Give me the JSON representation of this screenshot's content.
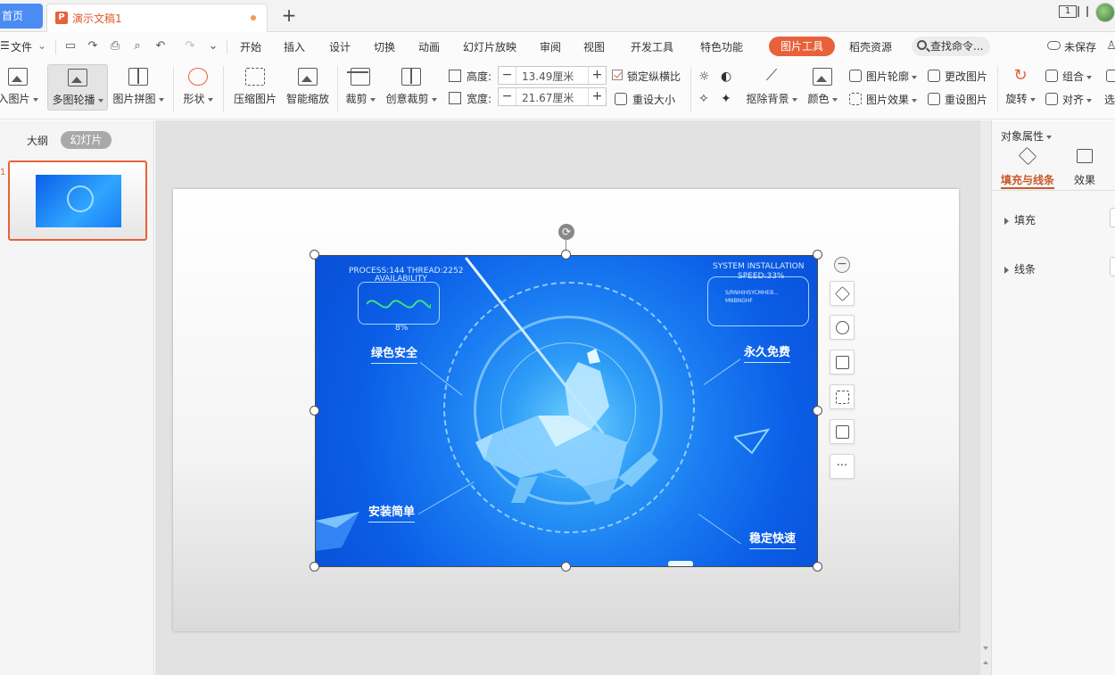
{
  "titlebar": {
    "home_tab": "首页",
    "doc_tab": "演示文稿1",
    "window_badge": "1"
  },
  "menu": {
    "file": "文件",
    "tabs": [
      "开始",
      "插入",
      "设计",
      "切换",
      "动画",
      "幻灯片放映",
      "审阅",
      "视图",
      "开发工具",
      "特色功能"
    ],
    "picture_tools": "图片工具",
    "resources": "稻壳资源",
    "search_placeholder": "查找命令...",
    "unsaved": "未保存"
  },
  "ribbon": {
    "insert_picture": "入图片",
    "multi_carousel": "多图轮播",
    "picture_collage": "图片拼图",
    "shape": "形状",
    "compress": "压缩图片",
    "smart_zoom": "智能缩放",
    "crop": "裁剪",
    "creative_crop": "创意裁剪",
    "height_label": "高度:",
    "height_value": "13.49厘米",
    "width_label": "宽度:",
    "width_value": "21.67厘米",
    "lock_ratio": "锁定纵横比",
    "reset_size": "重设大小",
    "remove_bg": "抠除背景",
    "color": "颜色",
    "picture_outline": "图片轮廓",
    "picture_effect": "图片效果",
    "change_picture": "更改图片",
    "reset_picture": "重设图片",
    "rotate": "旋转",
    "group": "组合",
    "align": "对齐",
    "select": "选"
  },
  "left_pane": {
    "outline_tab": "大纲",
    "slides_tab": "幻灯片",
    "slide_number": "1"
  },
  "picture": {
    "hud_left_top": "PROCESS:144  THREAD:2252",
    "hud_left_availability": "AVAILABILITY",
    "hud_left_percent": "8%",
    "hud_right_line1": "SYSTEM INSTALLATION",
    "hud_right_line2": "SPEED:33%",
    "hud_right_line3": "S/RNHIHSYCMHEB...",
    "hud_right_line4": "MNBNGHF",
    "feature_green_safe": "绿色安全",
    "feature_free": "永久免费",
    "feature_easy_install": "安装简单",
    "feature_stable_fast": "稳定快速"
  },
  "right_panel": {
    "title": "对象属性",
    "tab_fill_line": "填充与线条",
    "tab_effect": "效果",
    "section_fill": "填充",
    "section_line": "线条"
  },
  "colors": {
    "accent": "#e8613b",
    "home_tab": "#4b8cf2",
    "picture_blue": "#1a7cf2"
  },
  "icons": [
    "plus-icon",
    "save-icon",
    "print-icon",
    "undo-icon",
    "redo-icon",
    "search-icon",
    "cloud-icon",
    "rotate-icon",
    "layers-icon",
    "zoom-in-icon",
    "crop-icon",
    "more-icon",
    "minus-icon"
  ],
  "float_toolbar": {
    "more": "···"
  }
}
